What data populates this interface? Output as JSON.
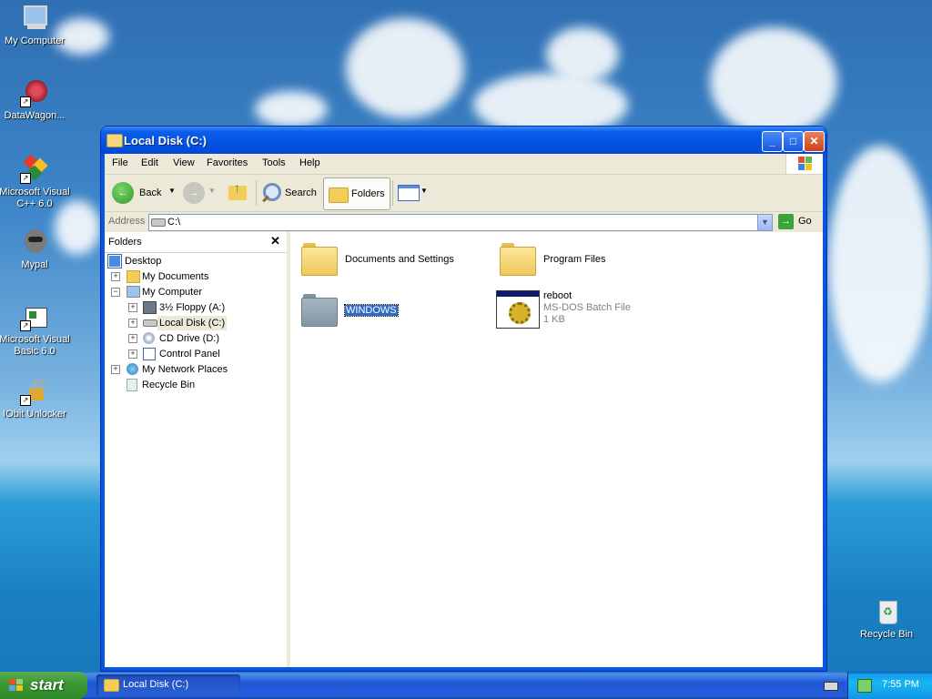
{
  "desktop": {
    "icons": [
      {
        "label": "My Computer",
        "icon": "my-computer-icon"
      },
      {
        "label": "DataWagon...",
        "icon": "datawagon-icon"
      },
      {
        "label": "Microsoft Visual C++ 6.0",
        "icon": "visual-cpp-icon"
      },
      {
        "label": "Mypal",
        "icon": "mypal-icon"
      },
      {
        "label": "Microsoft Visual Basic 6.0",
        "icon": "visual-basic-icon"
      },
      {
        "label": "IObit Unlocker",
        "icon": "iobit-unlocker-icon"
      },
      {
        "label": "Recycle Bin",
        "icon": "recycle-bin-icon"
      }
    ]
  },
  "window": {
    "title": "Local Disk (C:)",
    "menu": [
      "File",
      "Edit",
      "View",
      "Favorites",
      "Tools",
      "Help"
    ],
    "toolbar": {
      "back": "Back",
      "search": "Search",
      "folders": "Folders"
    },
    "address": {
      "label": "Address",
      "value": "C:\\",
      "go": "Go"
    },
    "folders_pane": {
      "title": "Folders",
      "tree": [
        {
          "label": "Desktop",
          "icon": "desktop-icon"
        },
        {
          "label": "My Documents",
          "icon": "my-documents-icon",
          "expander": "+"
        },
        {
          "label": "My Computer",
          "icon": "my-computer-icon",
          "expander": "−"
        },
        {
          "label": "3½ Floppy (A:)",
          "icon": "floppy-icon",
          "expander": "+"
        },
        {
          "label": "Local Disk (C:)",
          "icon": "hard-disk-icon",
          "expander": "+"
        },
        {
          "label": "CD Drive (D:)",
          "icon": "cd-drive-icon",
          "expander": "+"
        },
        {
          "label": "Control Panel",
          "icon": "control-panel-icon",
          "expander": "+"
        },
        {
          "label": "My Network Places",
          "icon": "network-places-icon",
          "expander": "+"
        },
        {
          "label": "Recycle Bin",
          "icon": "recycle-bin-icon"
        }
      ]
    },
    "files": [
      {
        "name": "Documents and Settings",
        "type": "folder"
      },
      {
        "name": "Program Files",
        "type": "folder"
      },
      {
        "name": "WINDOWS",
        "type": "folder",
        "selected": true
      },
      {
        "name": "reboot",
        "type": "batch",
        "desc": "MS-DOS Batch File",
        "size": "1 KB"
      }
    ]
  },
  "taskbar": {
    "start": "start",
    "task": "Local Disk (C:)",
    "clock": "7:55 PM"
  },
  "colors": {
    "titlebar": "#0055e5",
    "selection": "#316ac5",
    "folder_yellow": "#f6d870",
    "folder_gray": "#8fa3ae",
    "start_green": "#3c9a34"
  }
}
